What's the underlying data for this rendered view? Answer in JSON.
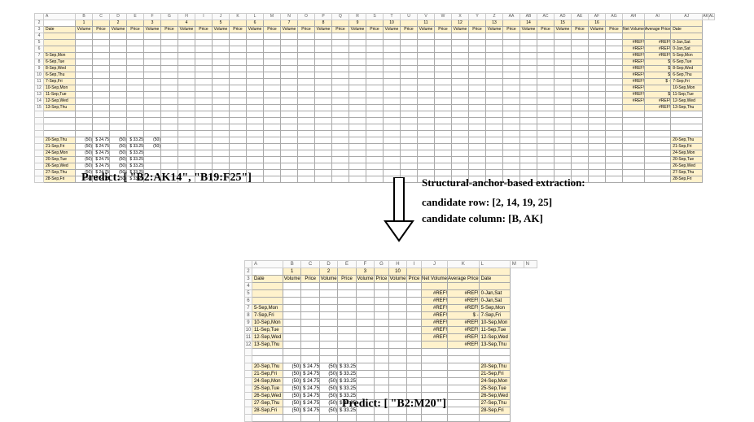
{
  "common": {
    "volume": "Volume",
    "price": "Price",
    "net_volume": "Net Volume",
    "avg_price": "Average Price",
    "date": "Date"
  },
  "top": {
    "cols": [
      "A",
      "B",
      "C",
      "D",
      "E",
      "F",
      "G",
      "H",
      "I",
      "J",
      "K",
      "L",
      "M",
      "N",
      "O",
      "P",
      "Q",
      "R",
      "S",
      "T",
      "U",
      "V",
      "W",
      "X",
      "Y",
      "Z",
      "AA",
      "AB",
      "AC",
      "AD",
      "AE",
      "AF",
      "AG",
      "AH",
      "AI",
      "AJ",
      "AK",
      "AL"
    ],
    "group_nums": [
      "1",
      "2",
      "3",
      "4",
      "5",
      "6",
      "7",
      "8",
      "9",
      "10",
      "11",
      "12",
      "13",
      "14",
      "15",
      "16"
    ],
    "rownums": [
      "",
      "2",
      "3",
      "4",
      "5",
      "6",
      "7",
      "8",
      "9",
      "10",
      "11",
      "12",
      "13",
      "14",
      "15",
      "16",
      "17",
      "18",
      "19",
      "20",
      "21",
      "22",
      "23",
      "24",
      "25",
      "26"
    ],
    "block1_rows": [
      {
        "d": "",
        "nv": "",
        "ap": "",
        "d2": ""
      },
      {
        "d": "",
        "nv": "#REF!",
        "ap": "#REF!",
        "d2": "0-Jan,Sat"
      },
      {
        "d": "",
        "nv": "#REF!",
        "ap": "#REF!",
        "d2": "0-Jan,Sat"
      },
      {
        "d": "5-Sep,Mon",
        "nv": "#REF!",
        "ap": "#REF!",
        "d2": "5-Sep,Mon"
      },
      {
        "d": "6-Sep,Tue",
        "nv": "#REF!",
        "ap": "$",
        "d2": "6-Sep,Tue"
      },
      {
        "d": "8-Sep,Wed",
        "nv": "#REF!",
        "ap": "$",
        "d2": "8-Sep,Wed"
      },
      {
        "d": "6-Sep,Thu",
        "nv": "#REF!",
        "ap": "$",
        "d2": "6-Sep,Thu"
      },
      {
        "d": "7-Sep,Fri",
        "nv": "#REF!",
        "ap": "$ -",
        "d2": "7-Sep,Fri"
      },
      {
        "d": "10-Sep,Mon",
        "nv": "#REF!",
        "ap": "",
        "d2": "10-Sep,Mon"
      },
      {
        "d": "11-Sep,Tue",
        "nv": "#REF!",
        "ap": "$",
        "d2": "11-Sep,Tue"
      },
      {
        "d": "12-Sep,Wed",
        "nv": "#REF!",
        "ap": "#REF!",
        "d2": "12-Sep,Wed"
      },
      {
        "d": "13-Sep,Thu",
        "nv": "",
        "ap": "#REF!",
        "d2": "13-Sep,Thu"
      }
    ],
    "block2_rows": [
      {
        "d": "20-Sep,Thu",
        "v": "(50)",
        "p": "$ 24.75",
        "v2": "(50)",
        "p2": "$ 33.25",
        "v3": "(50)",
        "d2": "20-Sep,Thu"
      },
      {
        "d": "21-Sep,Fri",
        "v": "(50)",
        "p": "$ 24.75",
        "v2": "(50)",
        "p2": "$ 33.25",
        "v3": "(50)",
        "d2": "21-Sep,Fri"
      },
      {
        "d": "24-Sep,Mon",
        "v": "(50)",
        "p": "$ 24.75",
        "v2": "(50)",
        "p2": "$ 33.25",
        "v3": "",
        "d2": "24-Sep,Mon"
      },
      {
        "d": "20-Sep,Tue",
        "v": "(50)",
        "p": "$ 24.75",
        "v2": "(50)",
        "p2": "$ 33.25",
        "v3": "",
        "d2": "20-Sep,Tue"
      },
      {
        "d": "26-Sep,Wed",
        "v": "(50)",
        "p": "$ 24.75",
        "v2": "(50)",
        "p2": "$ 33.25",
        "v3": "",
        "d2": "26-Sep,Wed"
      },
      {
        "d": "27-Sep,Thu",
        "v": "(50)",
        "p": "$ 24.75",
        "v2": "(50)",
        "p2": "$ 33.25",
        "v3": "",
        "d2": "27-Sep,Thu"
      },
      {
        "d": "28-Sep,Fri",
        "v": "(50)",
        "p": "$ 24.75",
        "v2": "(50)",
        "p2": "$ 33.25",
        "v3": "",
        "d2": "28-Sep,Fri"
      }
    ],
    "predict": "Predict: [ \"B2:AK14\", \"B19:F25\"]"
  },
  "rhs": {
    "title": "Structural-anchor-based extraction:",
    "row_label": "candidate row: [2, 14, 19, 25]",
    "col_label": "candidate column: [B, AK]"
  },
  "bot": {
    "cols": [
      "A",
      "B",
      "C",
      "D",
      "E",
      "F",
      "G",
      "H",
      "I",
      "J",
      "K",
      "L",
      "M",
      "N"
    ],
    "group_nums": [
      "1",
      "2",
      "3",
      "10"
    ],
    "rownums": [
      "",
      "2",
      "3",
      "4",
      "5",
      "6",
      "7",
      "8",
      "9",
      "10",
      "11",
      "12",
      "13",
      "14",
      "15",
      "16",
      "17",
      "18",
      "19",
      "20",
      "21"
    ],
    "block1_rows": [
      {
        "d": "",
        "nv": "",
        "ap": "",
        "d2": ""
      },
      {
        "d": "",
        "nv": "#REF!",
        "ap": "#REF!",
        "d2": "0-Jan,Sat"
      },
      {
        "d": "",
        "nv": "#REF!",
        "ap": "#REF!",
        "d2": "0-Jan,Sat"
      },
      {
        "d": "5-Sep,Mon",
        "nv": "#REF!",
        "ap": "#REF!",
        "d2": "5-Sep,Mon"
      },
      {
        "d": "7-Sep,Fri",
        "nv": "#REF!",
        "ap": "$ -",
        "d2": "7-Sep,Fri"
      },
      {
        "d": "10-Sep,Mon",
        "nv": "#REF!",
        "ap": "#REF!",
        "d2": "10-Sep,Mon"
      },
      {
        "d": "11-Sep,Tue",
        "nv": "#REF!",
        "ap": "#REF!",
        "d2": "11-Sep,Tue"
      },
      {
        "d": "12-Sep,Wed",
        "nv": "#REF!",
        "ap": "#REF!",
        "d2": "12-Sep,Wed"
      },
      {
        "d": "13-Sep,Thu",
        "nv": "",
        "ap": "#REF!",
        "d2": "13-Sep,Thu"
      }
    ],
    "block2_rows": [
      {
        "d": "20-Sep,Thu",
        "v": "(50)",
        "p": "$ 24.75",
        "v2": "(50)",
        "p2": "$ 33.25",
        "d2": "20-Sep,Thu"
      },
      {
        "d": "21-Sep,Fri",
        "v": "(50)",
        "p": "$ 24.75",
        "v2": "(50)",
        "p2": "$ 33.25",
        "d2": "21-Sep,Fri"
      },
      {
        "d": "24-Sep,Mon",
        "v": "(50)",
        "p": "$ 24.75",
        "v2": "(50)",
        "p2": "$ 33.25",
        "d2": "24-Sep,Mon"
      },
      {
        "d": "25-Sep,Tue",
        "v": "(50)",
        "p": "$ 24.75",
        "v2": "(50)",
        "p2": "$ 33.25",
        "d2": "25-Sep,Tue"
      },
      {
        "d": "26-Sep,Wed",
        "v": "(50)",
        "p": "$ 24.75",
        "v2": "(50)",
        "p2": "$ 33.25",
        "d2": "26-Sep,Wed"
      },
      {
        "d": "27-Sep,Thu",
        "v": "(50)",
        "p": "$ 24.75",
        "v2": "(50)",
        "p2": "$ 33.25",
        "d2": "27-Sep,Thu"
      },
      {
        "d": "28-Sep,Fri",
        "v": "(50)",
        "p": "$ 24.75",
        "v2": "(50)",
        "p2": "$ 33.25",
        "d2": "28-Sep,Fri"
      }
    ],
    "predict": "Predict: [ \"B2:M20\"]"
  }
}
